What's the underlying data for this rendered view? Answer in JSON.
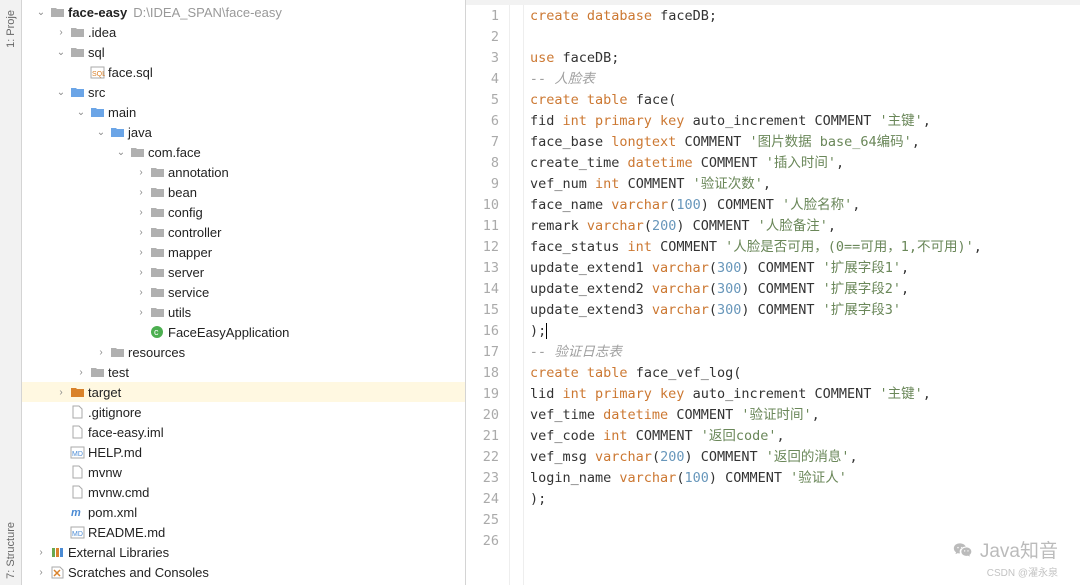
{
  "sidebar_tabs": {
    "top": "1: Proje",
    "bottom": "7: Structure"
  },
  "tree": [
    {
      "indent": 0,
      "chev": "down",
      "icon": "folder",
      "label": "face-easy",
      "bold": true,
      "hint": "D:\\IDEA_SPAN\\face-easy"
    },
    {
      "indent": 1,
      "chev": "right",
      "icon": "folder",
      "label": ".idea"
    },
    {
      "indent": 1,
      "chev": "down",
      "icon": "folder",
      "label": "sql"
    },
    {
      "indent": 2,
      "chev": "",
      "icon": "sql",
      "label": "face.sql"
    },
    {
      "indent": 1,
      "chev": "down",
      "icon": "folder-blue",
      "label": "src"
    },
    {
      "indent": 2,
      "chev": "down",
      "icon": "folder-blue",
      "label": "main"
    },
    {
      "indent": 3,
      "chev": "down",
      "icon": "folder-blue",
      "label": "java"
    },
    {
      "indent": 4,
      "chev": "down",
      "icon": "folder",
      "label": "com.face"
    },
    {
      "indent": 5,
      "chev": "right",
      "icon": "folder",
      "label": "annotation"
    },
    {
      "indent": 5,
      "chev": "right",
      "icon": "folder",
      "label": "bean"
    },
    {
      "indent": 5,
      "chev": "right",
      "icon": "folder",
      "label": "config"
    },
    {
      "indent": 5,
      "chev": "right",
      "icon": "folder",
      "label": "controller"
    },
    {
      "indent": 5,
      "chev": "right",
      "icon": "folder",
      "label": "mapper"
    },
    {
      "indent": 5,
      "chev": "right",
      "icon": "folder",
      "label": "server"
    },
    {
      "indent": 5,
      "chev": "right",
      "icon": "folder",
      "label": "service"
    },
    {
      "indent": 5,
      "chev": "right",
      "icon": "folder",
      "label": "utils"
    },
    {
      "indent": 5,
      "chev": "",
      "icon": "class",
      "label": "FaceEasyApplication"
    },
    {
      "indent": 3,
      "chev": "right",
      "icon": "folder",
      "label": "resources"
    },
    {
      "indent": 2,
      "chev": "right",
      "icon": "folder",
      "label": "test"
    },
    {
      "indent": 1,
      "chev": "right",
      "icon": "folder-orange",
      "label": "target",
      "highlighted": true
    },
    {
      "indent": 1,
      "chev": "",
      "icon": "file",
      "label": ".gitignore"
    },
    {
      "indent": 1,
      "chev": "",
      "icon": "file",
      "label": "face-easy.iml"
    },
    {
      "indent": 1,
      "chev": "",
      "icon": "md",
      "label": "HELP.md"
    },
    {
      "indent": 1,
      "chev": "",
      "icon": "file",
      "label": "mvnw"
    },
    {
      "indent": 1,
      "chev": "",
      "icon": "file",
      "label": "mvnw.cmd"
    },
    {
      "indent": 1,
      "chev": "",
      "icon": "maven",
      "label": "pom.xml"
    },
    {
      "indent": 1,
      "chev": "",
      "icon": "md",
      "label": "README.md"
    },
    {
      "indent": 0,
      "chev": "right",
      "icon": "lib",
      "label": "External Libraries"
    },
    {
      "indent": 0,
      "chev": "right",
      "icon": "scratch",
      "label": "Scratches and Consoles"
    }
  ],
  "code_lines": [
    {
      "n": 1,
      "tokens": [
        [
          "kw",
          "create"
        ],
        [
          " ",
          ""
        ],
        [
          "kw",
          "database"
        ],
        [
          " ",
          ""
        ],
        [
          "ident",
          "faceDB;"
        ]
      ]
    },
    {
      "n": 2,
      "tokens": []
    },
    {
      "n": 3,
      "tokens": [
        [
          "kw",
          "use"
        ],
        [
          " ",
          ""
        ],
        [
          "ident",
          "faceDB;"
        ]
      ]
    },
    {
      "n": 4,
      "tokens": [
        [
          "cmt",
          "-- 人脸表"
        ]
      ]
    },
    {
      "n": 5,
      "tokens": [
        [
          "kw",
          "create table"
        ],
        [
          " ",
          ""
        ],
        [
          "ident",
          "face("
        ]
      ]
    },
    {
      "n": 6,
      "tokens": [
        [
          "ident",
          "fid "
        ],
        [
          "kw",
          "int primary key"
        ],
        [
          " ",
          ""
        ],
        [
          "ident",
          "auto_increment COMMENT "
        ],
        [
          "str",
          "'主键'"
        ],
        [
          "ident",
          ","
        ]
      ]
    },
    {
      "n": 7,
      "tokens": [
        [
          "ident",
          "face_base "
        ],
        [
          "kw",
          "longtext"
        ],
        [
          " ",
          ""
        ],
        [
          "ident",
          "COMMENT "
        ],
        [
          "str",
          "'图片数据 base_64编码'"
        ],
        [
          "ident",
          ","
        ]
      ]
    },
    {
      "n": 8,
      "tokens": [
        [
          "ident",
          "create_time "
        ],
        [
          "kw",
          "datetime"
        ],
        [
          " ",
          ""
        ],
        [
          "ident",
          "COMMENT "
        ],
        [
          "str",
          "'插入时间'"
        ],
        [
          "ident",
          ","
        ]
      ]
    },
    {
      "n": 9,
      "tokens": [
        [
          "ident",
          "vef_num "
        ],
        [
          "kw",
          "int"
        ],
        [
          " ",
          ""
        ],
        [
          "ident",
          "COMMENT "
        ],
        [
          "str",
          "'验证次数'"
        ],
        [
          "ident",
          ","
        ]
      ]
    },
    {
      "n": 10,
      "tokens": [
        [
          "ident",
          "face_name "
        ],
        [
          "kw",
          "varchar"
        ],
        [
          "ident",
          "("
        ],
        [
          "num",
          "100"
        ],
        [
          "ident",
          ") COMMENT "
        ],
        [
          "str",
          "'人脸名称'"
        ],
        [
          "ident",
          ","
        ]
      ]
    },
    {
      "n": 11,
      "tokens": [
        [
          "ident",
          "remark "
        ],
        [
          "kw",
          "varchar"
        ],
        [
          "ident",
          "("
        ],
        [
          "num",
          "200"
        ],
        [
          "ident",
          ") COMMENT "
        ],
        [
          "str",
          "'人脸备注'"
        ],
        [
          "ident",
          ","
        ]
      ]
    },
    {
      "n": 12,
      "tokens": [
        [
          "ident",
          "face_status "
        ],
        [
          "kw",
          "int"
        ],
        [
          " ",
          ""
        ],
        [
          "ident",
          "COMMENT "
        ],
        [
          "str",
          "'人脸是否可用，(0==可用，1,不可用)'"
        ],
        [
          "ident",
          ","
        ]
      ]
    },
    {
      "n": 13,
      "tokens": [
        [
          "ident",
          "update_extend1 "
        ],
        [
          "kw",
          "varchar"
        ],
        [
          "ident",
          "("
        ],
        [
          "num",
          "300"
        ],
        [
          "ident",
          ") COMMENT "
        ],
        [
          "str",
          "'扩展字段1'"
        ],
        [
          "ident",
          ","
        ]
      ]
    },
    {
      "n": 14,
      "tokens": [
        [
          "ident",
          "update_extend2 "
        ],
        [
          "kw",
          "varchar"
        ],
        [
          "ident",
          "("
        ],
        [
          "num",
          "300"
        ],
        [
          "ident",
          ") COMMENT "
        ],
        [
          "str",
          "'扩展字段2'"
        ],
        [
          "ident",
          ","
        ]
      ]
    },
    {
      "n": 15,
      "tokens": [
        [
          "ident",
          "update_extend3 "
        ],
        [
          "kw",
          "varchar"
        ],
        [
          "ident",
          "("
        ],
        [
          "num",
          "300"
        ],
        [
          "ident",
          ") COMMENT "
        ],
        [
          "str",
          "'扩展字段3'"
        ]
      ]
    },
    {
      "n": 16,
      "tokens": [
        [
          "ident",
          ");"
        ]
      ],
      "caret": true
    },
    {
      "n": 17,
      "tokens": [
        [
          "cmt",
          "-- 验证日志表"
        ]
      ]
    },
    {
      "n": 18,
      "tokens": [
        [
          "kw",
          "create table"
        ],
        [
          " ",
          ""
        ],
        [
          "ident",
          "face_vef_log("
        ]
      ]
    },
    {
      "n": 19,
      "tokens": [
        [
          "ident",
          "lid "
        ],
        [
          "kw",
          "int primary key"
        ],
        [
          " ",
          ""
        ],
        [
          "ident",
          "auto_increment COMMENT "
        ],
        [
          "str",
          "'主键'"
        ],
        [
          "ident",
          ","
        ]
      ]
    },
    {
      "n": 20,
      "tokens": [
        [
          "ident",
          "vef_time "
        ],
        [
          "kw",
          "datetime"
        ],
        [
          " ",
          ""
        ],
        [
          "ident",
          "COMMENT "
        ],
        [
          "str",
          "'验证时间'"
        ],
        [
          "ident",
          ","
        ]
      ]
    },
    {
      "n": 21,
      "tokens": [
        [
          "ident",
          "vef_code "
        ],
        [
          "kw",
          "int"
        ],
        [
          " ",
          ""
        ],
        [
          "ident",
          "COMMENT "
        ],
        [
          "str",
          "'返回code'"
        ],
        [
          "ident",
          ","
        ]
      ]
    },
    {
      "n": 22,
      "tokens": [
        [
          "ident",
          "vef_msg "
        ],
        [
          "kw",
          "varchar"
        ],
        [
          "ident",
          "("
        ],
        [
          "num",
          "200"
        ],
        [
          "ident",
          ") COMMENT "
        ],
        [
          "str",
          "'返回的消息'"
        ],
        [
          "ident",
          ","
        ]
      ]
    },
    {
      "n": 23,
      "tokens": [
        [
          "ident",
          "login_name "
        ],
        [
          "kw",
          "varchar"
        ],
        [
          "ident",
          "("
        ],
        [
          "num",
          "100"
        ],
        [
          "ident",
          ") COMMENT "
        ],
        [
          "str",
          "'验证人'"
        ]
      ]
    },
    {
      "n": 24,
      "tokens": [
        [
          "ident",
          ");"
        ]
      ]
    },
    {
      "n": 25,
      "tokens": []
    },
    {
      "n": 26,
      "tokens": []
    }
  ],
  "watermark": {
    "main": "Java知音",
    "sub": "CSDN @濯永泉"
  }
}
